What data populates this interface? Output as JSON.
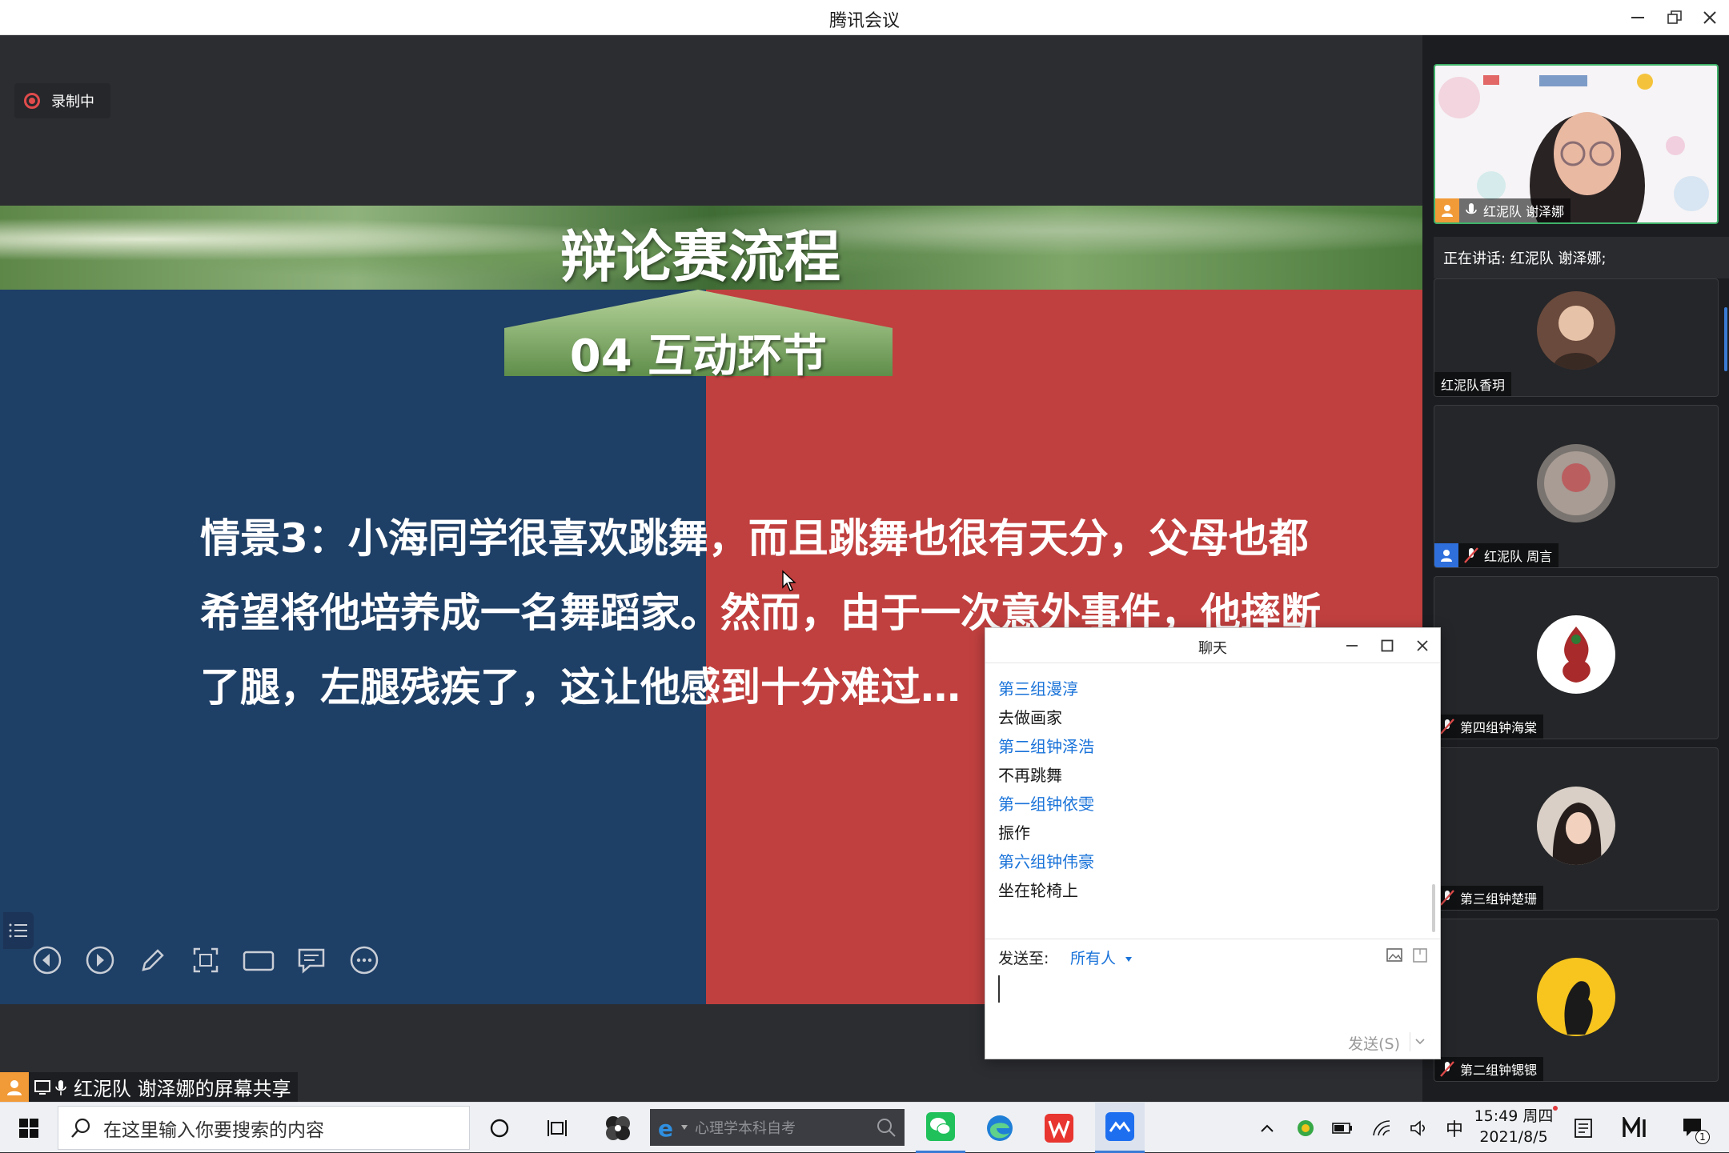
{
  "window": {
    "title": "腾讯会议"
  },
  "recording": {
    "label": "录制中"
  },
  "slide": {
    "banner_title": "辩论赛流程",
    "section_tag": "04 互动环节",
    "body_lines": [
      "情景3：小海同学很喜欢跳舞，而且跳舞也很有天分，父母也都",
      "希望将他培养成一名舞蹈家。然而，由于一次意外事件，他摔断",
      "了腿，左腿残疾了，这让他感到十分难过…"
    ]
  },
  "share_label": "红泥队 谢泽娜的屏幕共享",
  "participants": {
    "speaking_label": "正在讲话: 红泥队 谢泽娜;",
    "tiles": [
      {
        "name": "红泥队 谢泽娜"
      },
      {
        "name": "红泥队香玥"
      },
      {
        "name": "红泥队 周言"
      },
      {
        "name": "第四组钟海棠"
      },
      {
        "name": "第三组钟楚珊"
      },
      {
        "name": "第二组钟锶锶"
      }
    ]
  },
  "chat": {
    "title": "聊天",
    "messages": [
      {
        "sender": "第三组漫淳",
        "text": "去做画家"
      },
      {
        "sender": "第二组钟泽浩",
        "text": "不再跳舞"
      },
      {
        "sender": "第一组钟依雯",
        "text": "振作"
      },
      {
        "sender": "第六组钟伟豪",
        "text": "坐在轮椅上"
      }
    ],
    "send_to_label": "发送至:",
    "recipient": "所有人",
    "send_button": "发送(S)"
  },
  "taskbar": {
    "search_placeholder": "在这里输入你要搜索的内容",
    "address_placeholder": "心理学本科自考",
    "ime": "中",
    "time": "15:49 周四",
    "date": "2021/8/5",
    "notification_count": "1"
  }
}
